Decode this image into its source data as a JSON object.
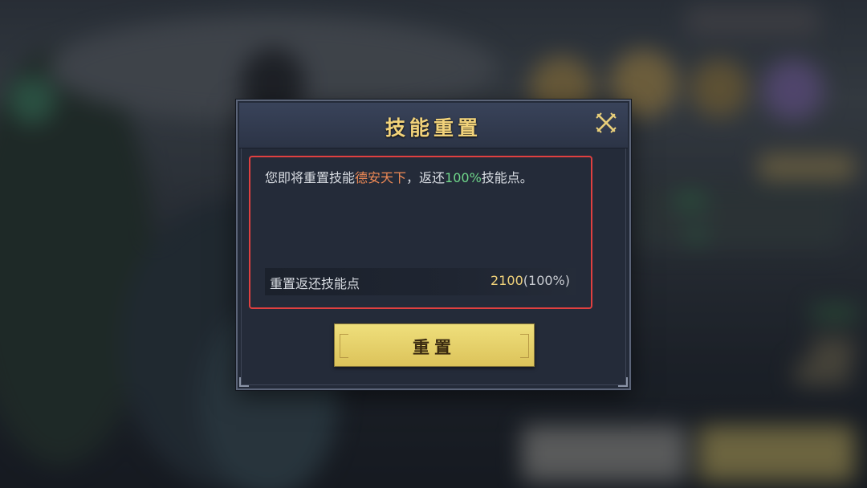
{
  "dialog": {
    "title": "技能重置",
    "message_prefix": "您即将重置技能",
    "skill_name": "德安天下",
    "message_mid": "，返还",
    "refund_percent": "100%",
    "message_suffix": "技能点。",
    "points_label": "重置返还技能点",
    "points_amount": "2100",
    "points_percent": "(100%)",
    "reset_button_label": "重置"
  },
  "icons": {
    "close": "close-crossed-swords-icon"
  },
  "colors": {
    "title_gold": "#f1d27a",
    "skill_highlight": "#f08a55",
    "percent_highlight": "#6fd68a",
    "annotation_red": "#e04040",
    "button_gold": "#e6d06a"
  }
}
